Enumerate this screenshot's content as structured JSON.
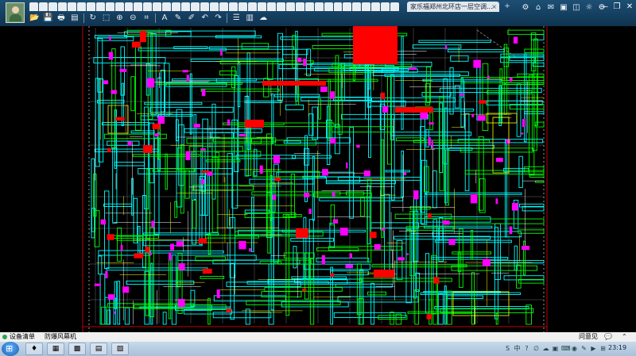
{
  "titlebar": {
    "file_tabs": [
      "",
      "",
      "",
      "",
      "",
      "",
      "",
      "",
      "",
      "",
      "",
      "",
      "",
      "",
      "",
      "",
      "",
      "",
      "",
      "",
      "",
      "",
      "",
      "",
      "",
      "",
      "",
      "",
      "",
      "",
      "",
      "",
      "",
      "",
      "",
      "",
      "",
      "",
      ""
    ],
    "active_tab_title": "家乐福郑州北环店一层空调...",
    "close_glyph": "×",
    "new_tab_glyph": "+"
  },
  "toolbar": {
    "buttons": [
      {
        "name": "open-icon",
        "glyph": "📂"
      },
      {
        "name": "save-icon",
        "glyph": "💾"
      },
      {
        "name": "print-icon",
        "glyph": "🖶"
      },
      {
        "name": "preview-icon",
        "glyph": "▤"
      },
      {
        "name": "rotate-icon",
        "glyph": "↻"
      },
      {
        "name": "zoom-window-icon",
        "glyph": "⬚"
      },
      {
        "name": "zoom-in-icon",
        "glyph": "⊕"
      },
      {
        "name": "zoom-out-icon",
        "glyph": "⊖"
      },
      {
        "name": "measure-icon",
        "glyph": "⌗"
      },
      {
        "name": "text-icon",
        "glyph": "A"
      },
      {
        "name": "pen-icon",
        "glyph": "✎"
      },
      {
        "name": "brush-icon",
        "glyph": "✐"
      },
      {
        "name": "undo-icon",
        "glyph": "↶"
      },
      {
        "name": "redo-icon",
        "glyph": "↷"
      },
      {
        "name": "layers-icon",
        "glyph": "☰"
      },
      {
        "name": "layout-icon",
        "glyph": "▥"
      },
      {
        "name": "cloud-icon",
        "glyph": "☁"
      }
    ]
  },
  "system_icons": [
    "⚙",
    "⌂",
    "✉",
    "▣",
    "◫",
    "☼",
    "⚙"
  ],
  "window_controls": {
    "minimize": "—",
    "restore": "❐",
    "close": "✕"
  },
  "statusbar": {
    "left_item_1": "设备清单",
    "left_item_2": "防爆风幕机",
    "right_item_1": "问意见",
    "right_item_2": "💬",
    "right_item_3": "⌃"
  },
  "taskbar": {
    "start_glyph": "⊞",
    "apps": [
      "♦",
      "▦",
      "▩",
      "▤",
      "▨"
    ],
    "tray": [
      "S",
      "中",
      "?",
      "∅",
      "☁",
      "▣",
      "⌨",
      "◉",
      "✎",
      "▶",
      "⊞"
    ],
    "clock": "23:19"
  },
  "colors": {
    "cyan": "#00ffff",
    "green": "#00ff00",
    "magenta": "#ff00ff",
    "red": "#ff0000",
    "yellow": "#ffff00",
    "white": "#ffffff",
    "frame_red": "#c00000"
  }
}
